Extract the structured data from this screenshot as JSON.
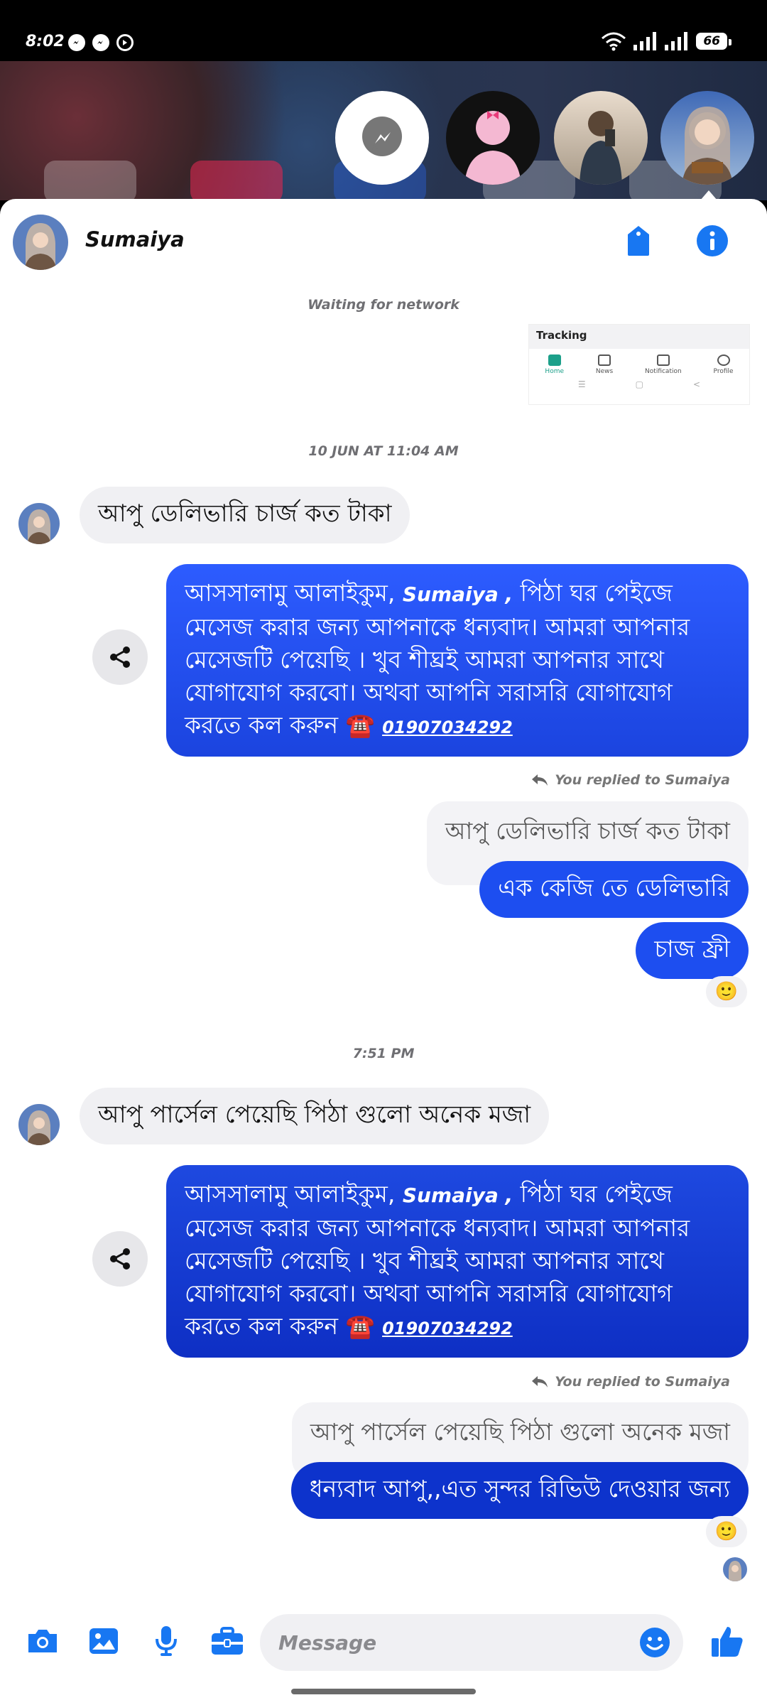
{
  "status_bar": {
    "time": "8:02",
    "battery": "66"
  },
  "chat": {
    "contact_name": "Sumaiya",
    "network_status": "Waiting for network",
    "thumbnail": {
      "title": "Tracking",
      "nav": [
        "Home",
        "News",
        "Notification",
        "Profile"
      ]
    }
  },
  "conversation": {
    "block1": {
      "timestamp": "10 JUN AT 11:04 AM",
      "incoming": "আপু ডেলিভারি চার্জ কত টাকা",
      "auto_reply": {
        "before_name": "আসসালামু আলাইকুম, ",
        "name": "Sumaiya ,",
        "after_name": " পিঠা ঘর পেইজে মেসেজ করার জন্য আপনাকে ধন্যবাদ। আমরা আপনার মেসেজটি পেয়েছি । খুব শীঘ্রই আমরা আপনার সাথে যোগাযোগ করবো। অথবা আপনি সরাসরি যোগাযোগ করতে কল করুন ☎️ ",
        "phone": "01907034292"
      },
      "replied_label": "You replied to Sumaiya",
      "quoted": "আপু ডেলিভারি চার্জ কত টাকা",
      "reply_1": "এক কেজি তে ডেলিভারি",
      "reply_2": "চাজ ফ্রী",
      "reaction": "🙂"
    },
    "block2": {
      "timestamp": "7:51 PM",
      "incoming": "আপু পার্সেল পেয়েছি পিঠা গুলো অনেক মজা",
      "auto_reply": {
        "before_name": "আসসালামু আলাইকুম, ",
        "name": "Sumaiya ,",
        "after_name": " পিঠা ঘর পেইজে মেসেজ করার জন্য আপনাকে ধন্যবাদ। আমরা আপনার মেসেজটি পেয়েছি । খুব শীঘ্রই আমরা আপনার সাথে যোগাযোগ করবো। অথবা আপনি সরাসরি যোগাযোগ করতে কল করুন ☎️ ",
        "phone": "01907034292"
      },
      "replied_label": "You replied to Sumaiya",
      "quoted": "আপু পার্সেল পেয়েছি পিঠা গুলো অনেক মজা",
      "reply_1": "ধন্যবাদ আপু,,এত সুন্দর রিভিউ দেওয়ার জন্য",
      "reaction": "🙂"
    }
  },
  "composer": {
    "placeholder": "Message"
  },
  "colors": {
    "accent": "#1877f2",
    "bubble_out": "#1d4ef0",
    "bubble_in": "#f0f0f3"
  }
}
